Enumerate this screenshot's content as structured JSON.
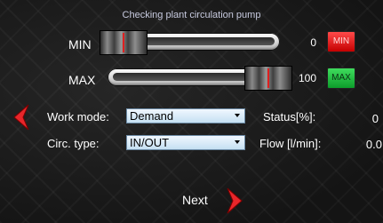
{
  "title": "Checking plant circulation pump",
  "min": {
    "label": "MIN",
    "value": "0",
    "button": "MIN",
    "slider_fraction": 0.0
  },
  "max": {
    "label": "MAX",
    "value": "100",
    "button": "MAX",
    "slider_fraction": 1.0
  },
  "work_mode": {
    "label": "Work mode:",
    "value": "Demand"
  },
  "circ_type": {
    "label": "Circ. type:",
    "value": "IN/OUT"
  },
  "status": {
    "label": "Status[%]:",
    "value": "0"
  },
  "flow": {
    "label": "Flow [l/min]:",
    "value": "0.0"
  },
  "nav": {
    "next_label": "Next"
  },
  "colors": {
    "min_button": "#e81c1c",
    "max_button": "#1fbf3d",
    "arrow": "#e8262a",
    "select_bg": "#dbeaf7"
  },
  "icons": {
    "back": "left-arrow-icon",
    "next": "right-arrow-icon",
    "dropdown": "chevron-down-icon"
  }
}
